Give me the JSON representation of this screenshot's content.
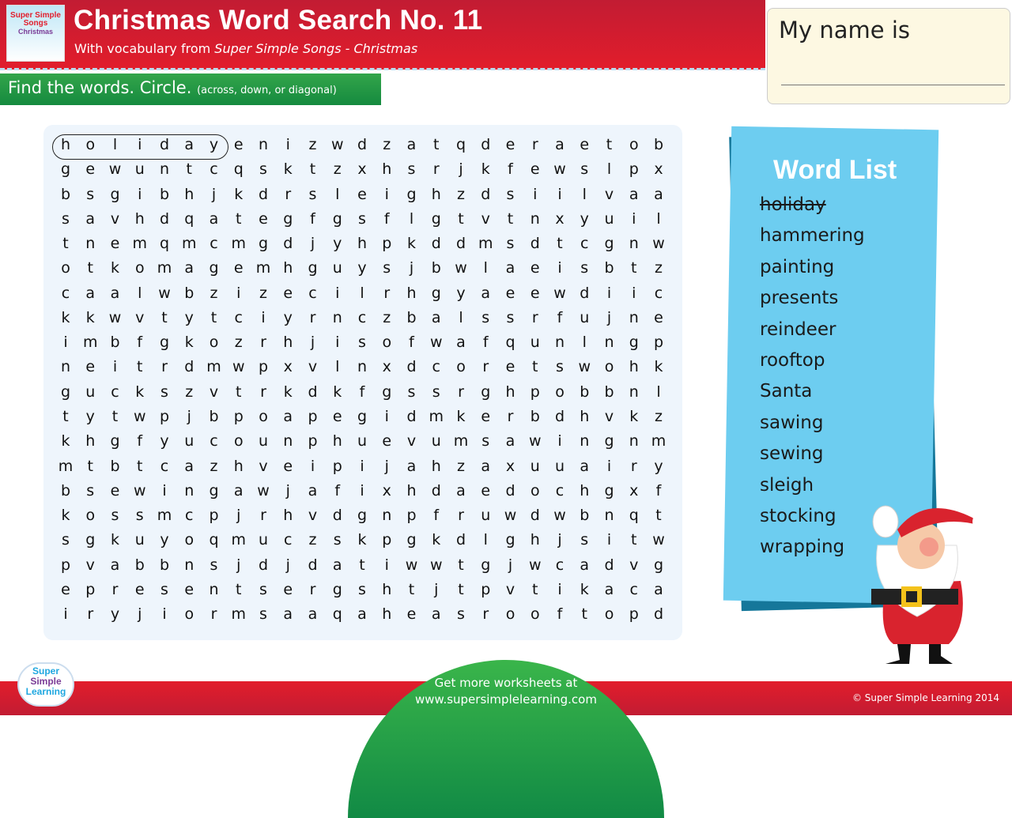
{
  "header": {
    "cover_art": "Super Simple Songs Christmas",
    "title": "Christmas Word Search No. 11",
    "subtitle_prefix": "With vocabulary from ",
    "subtitle_source": "Super Simple Songs - Christmas"
  },
  "instructions": {
    "main": "Find the words. Circle.",
    "note": "(across, down, or diagonal)"
  },
  "name_box": {
    "label": "My name is"
  },
  "grid": {
    "rows": [
      "holidayenizwdzatqderaetob",
      "gewuntcqsktzxhsrjkfewslpx",
      "bsgibhjkdrsleighzdsiilvaa",
      "savhdqategfgsflgtvtnxyuil",
      "tnemqmcmgdjyhpkddmsdtcgnw",
      "otkomagemhguysjbwlaeisbtz",
      "caalwbzizecilrhgyaeewdiic",
      "kkwvtytciyrnczbalssrfujne",
      "imbfgkozrhjisofwafqunlngp",
      "neitrdmwpxvlnxdcoretswohk",
      "guckszvtrkdkfgssrghpobbnl",
      "tytwpjbpoapegidmkerbdhvkz",
      "khgfyucounphuevumsawingnm",
      "mtbtcazhveipijahzaxuuairy",
      "bsewingawjafixhdaedochgxf",
      "kossmcpjrhvdgnpfruwdwbnqt",
      "sgkuyoqmuczskpgkdlghjsitw",
      "pvabbnsjdjdatiwwtgjwcadvg",
      "epresentsergshtjtpvtikaca",
      "iryjiormsaaqaheasrooftopd"
    ],
    "circled_example": "holiday"
  },
  "word_list": {
    "title": "Word List",
    "words": [
      {
        "text": "holiday",
        "found": true
      },
      {
        "text": "hammering"
      },
      {
        "text": "painting"
      },
      {
        "text": "presents"
      },
      {
        "text": "reindeer"
      },
      {
        "text": "rooftop"
      },
      {
        "text": "Santa"
      },
      {
        "text": "sawing"
      },
      {
        "text": "sewing"
      },
      {
        "text": "sleigh"
      },
      {
        "text": "stocking"
      },
      {
        "text": "wrapping"
      }
    ]
  },
  "footer": {
    "logo": "Super Simple Learning",
    "line1": "Get more worksheets at",
    "line2": "www.supersimplelearning.com",
    "copyright": "© Super Simple Learning 2014"
  },
  "colors": {
    "header_red": "#e21d2b",
    "instruction_green": "#1f9a44",
    "word_list_blue": "#6dcdf0",
    "panel": "#eef5fc"
  }
}
